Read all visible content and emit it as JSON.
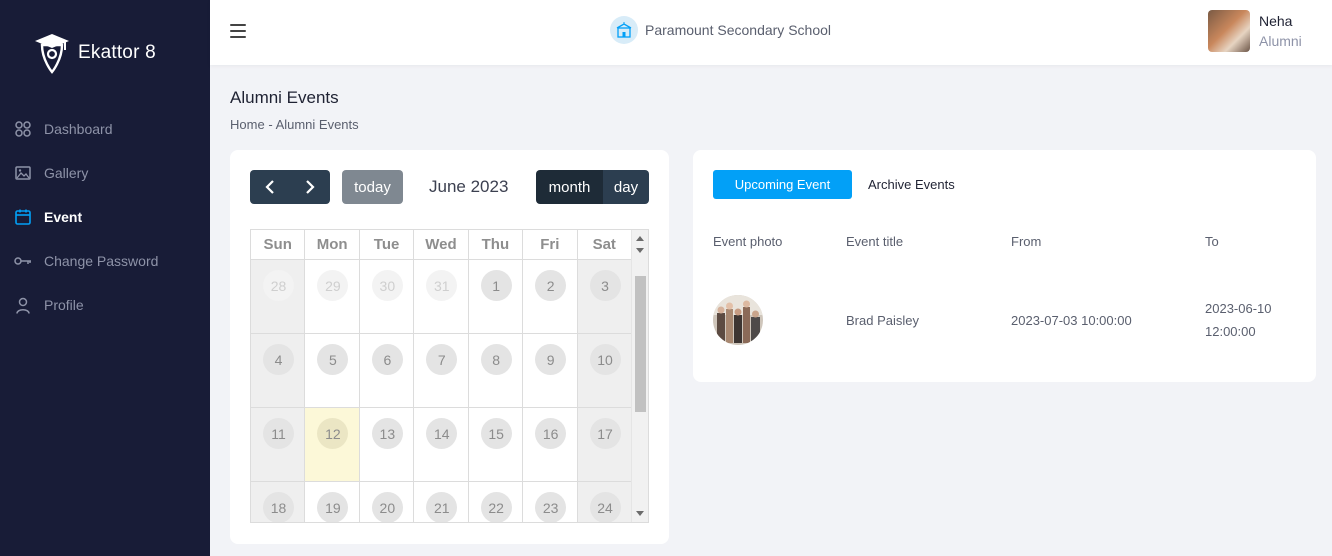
{
  "app": {
    "brand": "Ekattor 8"
  },
  "sidebar": {
    "items": [
      {
        "label": "Dashboard",
        "icon": "dashboard-icon"
      },
      {
        "label": "Gallery",
        "icon": "gallery-icon"
      },
      {
        "label": "Event",
        "icon": "calendar-icon",
        "active": true
      },
      {
        "label": "Change Password",
        "icon": "key-icon"
      },
      {
        "label": "Profile",
        "icon": "user-icon"
      }
    ]
  },
  "header": {
    "school_name": "Paramount Secondary School",
    "user": {
      "name": "Neha",
      "role": "Alumni"
    }
  },
  "page": {
    "title": "Alumni Events",
    "breadcrumb": {
      "home": "Home",
      "sep": "-",
      "current": "Alumni Events"
    }
  },
  "calendar": {
    "title": "June 2023",
    "today_label": "today",
    "month_label": "month",
    "day_label": "day",
    "days_of_week": [
      "Sun",
      "Mon",
      "Tue",
      "Wed",
      "Thu",
      "Fri",
      "Sat"
    ],
    "weeks": [
      [
        "28",
        "29",
        "30",
        "31",
        "1",
        "2",
        "3"
      ],
      [
        "4",
        "5",
        "6",
        "7",
        "8",
        "9",
        "10"
      ],
      [
        "11",
        "12",
        "13",
        "14",
        "15",
        "16",
        "17"
      ],
      [
        "18",
        "19",
        "20",
        "21",
        "22",
        "23",
        "24"
      ]
    ],
    "today": "12"
  },
  "events": {
    "tabs": {
      "upcoming": "Upcoming Event",
      "archive": "Archive Events"
    },
    "columns": {
      "photo": "Event photo",
      "title": "Event title",
      "from": "From",
      "to": "To"
    },
    "rows": [
      {
        "title": "Brad Paisley",
        "from": "2023-07-03 10:00:00",
        "to_date": "2023-06-10",
        "to_time": "12:00:00"
      }
    ]
  },
  "colors": {
    "sidebar_bg": "#181c37",
    "accent": "#02a0f7",
    "calendar_button": "#2c3e50",
    "today_highlight": "#fcf8d8"
  }
}
